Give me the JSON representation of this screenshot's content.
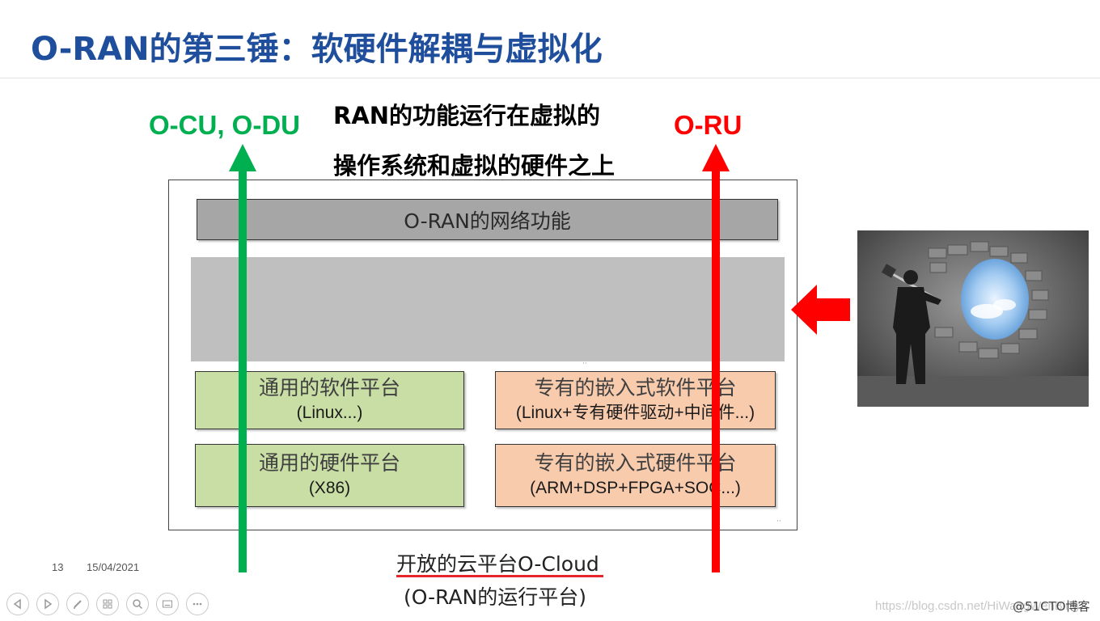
{
  "slide": {
    "title": "O-RAN的第三锤：软硬件解耦与虚拟化",
    "page_number": "13",
    "date": "15/04/2021"
  },
  "diagram": {
    "left_label": "O-CU, O-DU",
    "right_label": "O-RU",
    "caption_line1": "RAN的功能运行在虚拟的",
    "caption_line2": "操作系统和虚拟的硬件之上",
    "network_function": "O-RAN的网络功能",
    "generic_software": {
      "main": "通用的软件平台",
      "sub": "(Linux...)"
    },
    "dedicated_software": {
      "main": "专有的嵌入式软件平台",
      "sub": "(Linux+专有硬件驱动+中间件...)"
    },
    "generic_hardware": {
      "main": "通用的硬件平台",
      "sub": "(X86)"
    },
    "dedicated_hardware": {
      "main": "专有的嵌入式硬件平台",
      "sub": "(ARM+DSP+FPGA+SOC...)"
    },
    "bottom_line1": "开放的云平台O-Cloud",
    "bottom_line2": "(O-RAN的运行平台)",
    "colors": {
      "green": "#00b050",
      "red": "#ff0000",
      "title": "#1f4e9c"
    }
  },
  "toolbar": {
    "icons": [
      "previous-icon",
      "next-icon",
      "pen-icon",
      "slides-icon",
      "zoom-icon",
      "subtitles-icon",
      "more-icon"
    ]
  },
  "footer": {
    "watermark": "https://blog.csdn.net/HiWangWenBing",
    "brand": "@51CTO博客"
  }
}
